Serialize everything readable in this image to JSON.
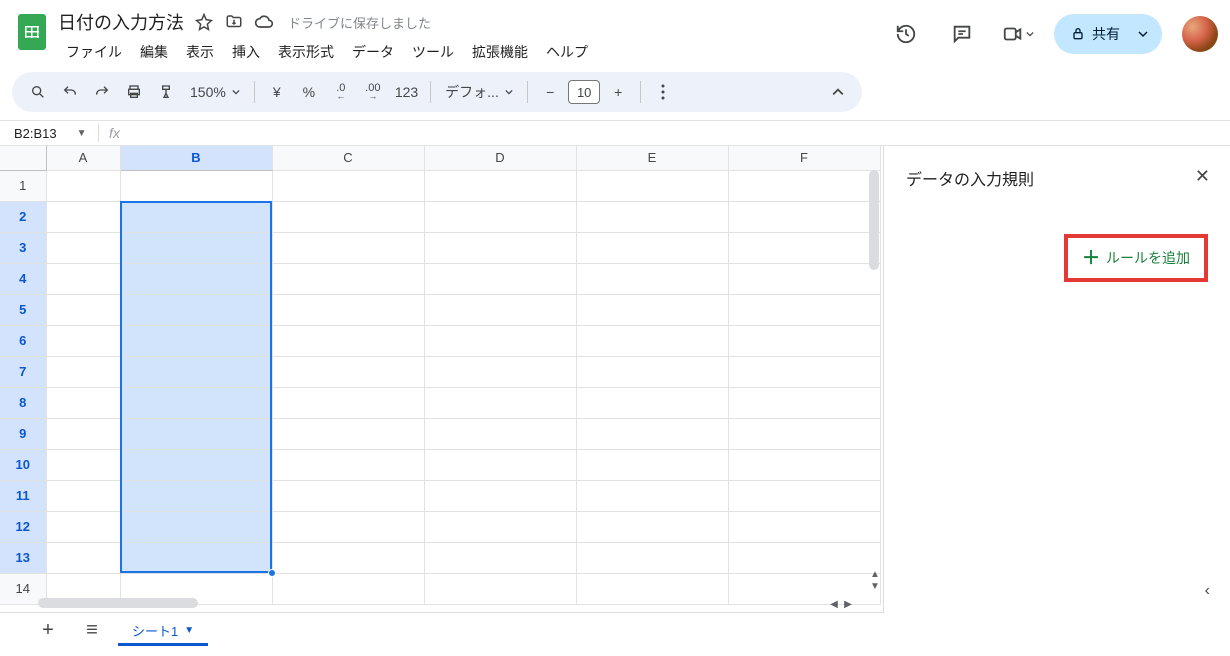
{
  "doc": {
    "title": "日付の入力方法",
    "save_status": "ドライブに保存しました"
  },
  "menus": [
    "ファイル",
    "編集",
    "表示",
    "挿入",
    "表示形式",
    "データ",
    "ツール",
    "拡張機能",
    "ヘルプ"
  ],
  "share": {
    "label": "共有"
  },
  "toolbar": {
    "zoom": "150%",
    "currency": "¥",
    "percent": "%",
    "dec_dec": ".0",
    "inc_dec": ".00",
    "number_format": "123",
    "font": "デフォ...",
    "minus": "−",
    "font_size": "10",
    "plus": "+"
  },
  "name_box": {
    "value": "B2:B13"
  },
  "fx": {
    "label": "fx"
  },
  "columns": [
    "A",
    "B",
    "C",
    "D",
    "E",
    "F"
  ],
  "rows": [
    "1",
    "2",
    "3",
    "4",
    "5",
    "6",
    "7",
    "8",
    "9",
    "10",
    "11",
    "12",
    "13",
    "14"
  ],
  "selected_col": "B",
  "selected_rows_start": 2,
  "selected_rows_end": 13,
  "side_panel": {
    "title": "データの入力規則",
    "add_rule": "ルールを追加"
  },
  "sheet_tab": {
    "name": "シート1"
  }
}
